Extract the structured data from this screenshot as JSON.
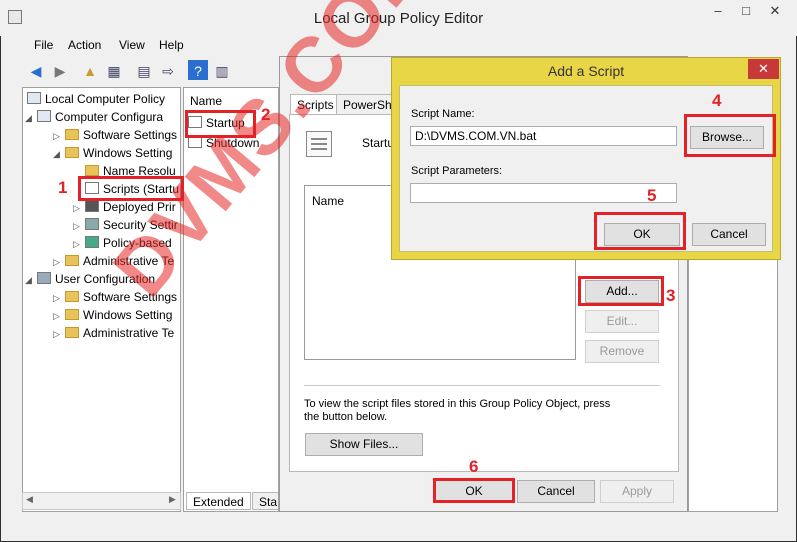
{
  "window": {
    "title": "Local Group Policy Editor",
    "minimize": "–",
    "maximize": "□",
    "close": "✕"
  },
  "menu": [
    "File",
    "Action",
    "View",
    "Help"
  ],
  "tree": [
    {
      "label": "Local Computer Policy",
      "icon": "computer-icon",
      "expander": ""
    },
    {
      "label": "Computer Configura",
      "icon": "computer-icon",
      "expander": "◢"
    },
    {
      "label": "Software Settings",
      "icon": "folder-icon",
      "expander": "▷"
    },
    {
      "label": "Windows Setting",
      "icon": "folder-icon",
      "expander": "◢"
    },
    {
      "label": "Name Resolu",
      "icon": "folder-icon",
      "expander": ""
    },
    {
      "label": "Scripts (Startu",
      "icon": "scripts-icon",
      "expander": ""
    },
    {
      "label": "Deployed Prir",
      "icon": "printer-icon",
      "expander": "▷"
    },
    {
      "label": "Security Settir",
      "icon": "security-icon",
      "expander": "▷"
    },
    {
      "label": "Policy-based",
      "icon": "chart-icon",
      "expander": "▷"
    },
    {
      "label": "Administrative Te",
      "icon": "folder-icon",
      "expander": "▷"
    },
    {
      "label": "User Configuration",
      "icon": "user-icon",
      "expander": "◢"
    },
    {
      "label": "Software Settings",
      "icon": "folder-icon",
      "expander": "▷"
    },
    {
      "label": "Windows Setting",
      "icon": "folder-icon",
      "expander": "▷"
    },
    {
      "label": "Administrative Te",
      "icon": "folder-icon",
      "expander": "▷"
    }
  ],
  "middle": {
    "header": "Name",
    "items": [
      "Startup",
      "Shutdown"
    ],
    "tabs": [
      "Extended",
      "Sta"
    ]
  },
  "props": {
    "tabs": [
      "Scripts",
      "PowerShel"
    ],
    "heading": "Startup",
    "list_header": "Name",
    "buttons": {
      "add": "Add...",
      "edit": "Edit...",
      "remove": "Remove"
    },
    "info": "To view the script files stored in this Group Policy Object, press the button below.",
    "show_files": "Show Files...",
    "ok": "OK",
    "cancel": "Cancel",
    "apply": "Apply"
  },
  "dialog": {
    "title": "Add a Script",
    "close": "✕",
    "script_name_label": "Script Name:",
    "script_name_value": "D:\\DVMS.COM.VN.bat",
    "browse": "Browse...",
    "params_label": "Script Parameters:",
    "params_value": "",
    "ok": "OK",
    "cancel": "Cancel"
  },
  "annotations": [
    "1",
    "2",
    "3",
    "4",
    "5",
    "6"
  ],
  "watermark": "DVMS.COM.VN",
  "colors": {
    "highlight": "#e32227",
    "dialog_frame": "#e9d647",
    "close_red": "#c7383a"
  }
}
